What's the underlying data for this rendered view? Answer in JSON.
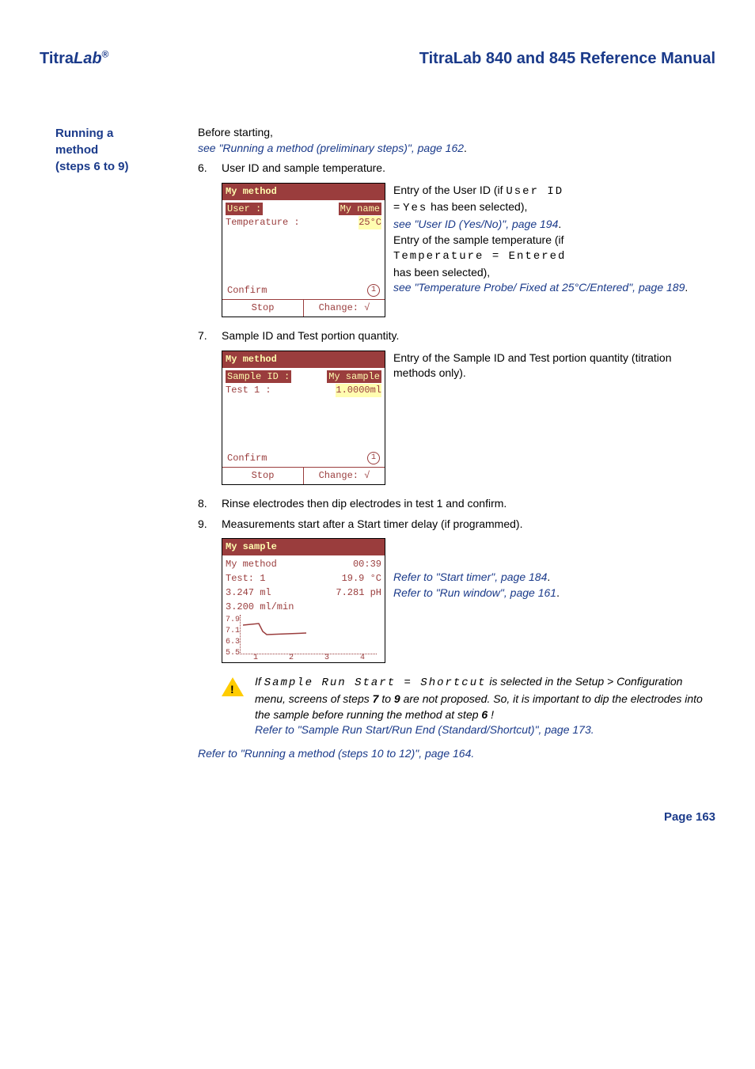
{
  "header": {
    "brand_pre": "Titra",
    "brand_lab": "Lab",
    "brand_reg": "®",
    "doc_title": "TitraLab 840 and 845 Reference Manual"
  },
  "sidebar": {
    "line1": "Running a",
    "line2": "method",
    "line3": "(steps 6 to 9)"
  },
  "intro": {
    "before": "Before starting,",
    "link1": " see \"Running a method (preliminary steps)\", page 162",
    "dot": "."
  },
  "step6": {
    "num": "6.",
    "text": "User ID and sample temperature.",
    "lcd": {
      "title": "My method",
      "user_lbl": "User :",
      "user_val": "My name",
      "temp_lbl": "Temperature :",
      "temp_val": "25°C",
      "confirm": "Confirm",
      "circ": "1",
      "stop": "Stop",
      "change": "Change: √"
    },
    "side": {
      "l1a": "Entry of the User ID (if ",
      "l1b": "User ID",
      "l2a": "= ",
      "l2b": "Yes",
      "l2c": " has been selected),",
      "link1": " see \"User ID (Yes/No)\", page 194",
      "l3": "Entry of the sample temperature (if",
      "l4": "Temperature = Entered",
      "l5": "has been selected),",
      "link2": " see \"Temperature Probe/ Fixed at 25°C/Entered\", page 189",
      "dot": "."
    }
  },
  "step7": {
    "num": "7.",
    "text": "Sample ID and Test portion quantity.",
    "lcd": {
      "title": "My method",
      "sample_lbl": "Sample ID :",
      "sample_val": "My sample",
      "test_lbl": "Test 1 :",
      "test_val": "1.0000ml",
      "confirm": "Confirm",
      "circ": "1",
      "stop": "Stop",
      "change": "Change: √"
    },
    "side": "Entry of the Sample ID and Test portion quantity (titration methods only)."
  },
  "step8": {
    "num": "8.",
    "text": "Rinse electrodes then dip electrodes in test 1 and confirm."
  },
  "step9": {
    "num": "9.",
    "text": "Measurements start after a Start timer delay (if programmed).",
    "lcd": {
      "title": "My sample",
      "method": "My method",
      "time": "00:39",
      "test": "Test: 1",
      "temp": "19.9 °C",
      "vol": "3.247 ml",
      "ph": "7.281 pH",
      "rate": "3.200 ml/min"
    },
    "side": {
      "link1": "Refer to \"Start timer\", page 184",
      "link2": "Refer to \"Run window\", page 161",
      "dot": "."
    }
  },
  "chart_data": {
    "type": "line",
    "x": [
      1,
      2,
      3,
      4
    ],
    "y_ticks": [
      5.5,
      6.3,
      7.1,
      7.9
    ],
    "xlabel": "",
    "ylabel": "",
    "series": [
      {
        "name": "pH",
        "x": [
          1.0,
          1.4,
          1.5,
          1.6,
          2.6
        ],
        "y": [
          7.2,
          7.25,
          7.0,
          6.9,
          6.95
        ]
      }
    ],
    "ylim": [
      5.5,
      7.9
    ]
  },
  "warn": {
    "l1a": "If ",
    "l1b": "Sample Run Start = Shortcut",
    "l1c": " is selected in the Setup > Configuration menu, screens of steps ",
    "s7": "7",
    "to": " to ",
    "s9": "9",
    "l1d": " are not proposed. So, it is important to dip the electrodes into the sample before running the method at step ",
    "s6": "6",
    "excl": " !",
    "link": "Refer to \"Sample Run Start/Run End (Standard/Shortcut)\", page 173",
    "dot": "."
  },
  "outro": {
    "link": "Refer to \"Running a method (steps 10 to 12)\", page 164",
    "dot": "."
  },
  "page": "Page 163"
}
